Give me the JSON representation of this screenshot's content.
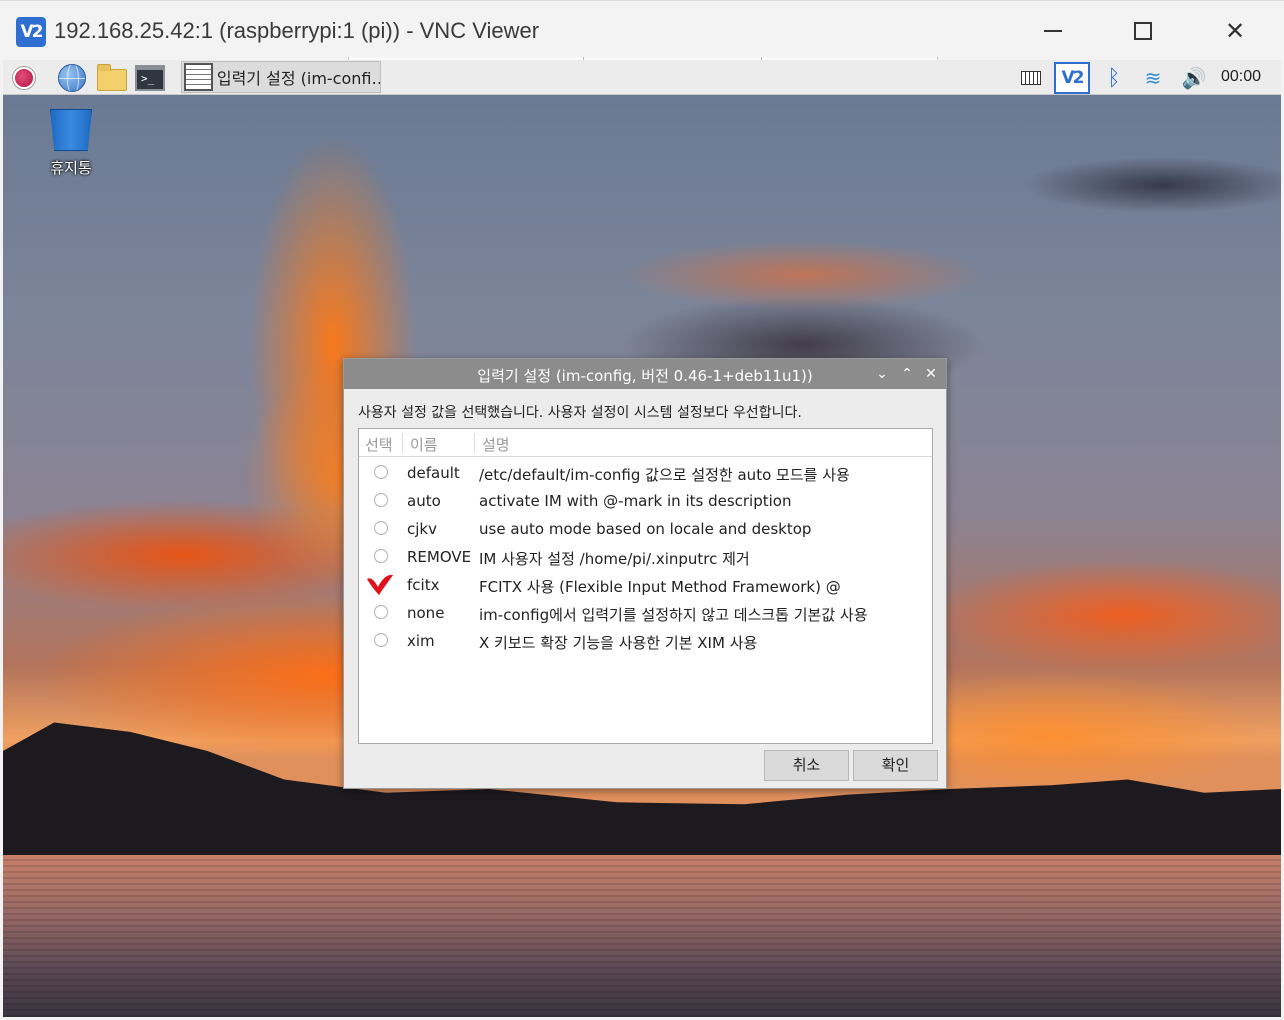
{
  "vnc": {
    "logo": "V2",
    "title": "192.168.25.42:1 (raspberrypi:1 (pi)) - VNC Viewer",
    "minimize_icon": "minimize-icon",
    "maximize_icon": "maximize-icon",
    "close_glyph": "✕"
  },
  "taskbar": {
    "launchers": [
      "raspberry-menu-icon",
      "browser-globe-icon",
      "file-manager-icon",
      "terminal-icon"
    ],
    "terminal_glyph": ">_",
    "active_task_label": "입력기 설정 (im-confi…",
    "tray_icons": [
      "keyboard-icon",
      "vnc-server-icon",
      "bluetooth-icon",
      "wifi-icon",
      "volume-icon"
    ],
    "vnc_tray_glyph": "V2",
    "bluetooth_glyph": "ᛒ",
    "wifi_glyph": "≋",
    "volume_glyph": "🔊",
    "clock": "00:00"
  },
  "desktop": {
    "trash_label": "휴지통"
  },
  "dialog": {
    "title": "입력기 설정 (im-config, 버전 0.46-1+deb11u1))",
    "controls": {
      "minimize": "⌄",
      "maximize": "⌃",
      "close": "✕"
    },
    "message": "사용자 설정 값을 선택했습니다. 사용자 설정이 시스템 설정보다 우선합니다.",
    "columns": [
      "선택",
      "이름",
      "설명"
    ],
    "rows": [
      {
        "selected": false,
        "name": "default",
        "desc": "/etc/default/im-config 값으로 설정한 auto 모드를 사용"
      },
      {
        "selected": false,
        "name": "auto",
        "desc": "activate IM with @-mark in its description"
      },
      {
        "selected": false,
        "name": "cjkv",
        "desc": "use auto mode based on locale and desktop"
      },
      {
        "selected": false,
        "name": "REMOVE",
        "desc": "IM 사용자 설정 /home/pi/.xinputrc 제거"
      },
      {
        "selected": true,
        "name": "fcitx",
        "desc": "FCITX 사용 (Flexible Input Method Framework) @"
      },
      {
        "selected": false,
        "name": "none",
        "desc": "im-config에서 입력기를 설정하지 않고 데스크톱 기본값 사용"
      },
      {
        "selected": false,
        "name": "xim",
        "desc": "X 키보드 확장 기능을 사용한 기본 XIM 사용"
      }
    ],
    "cancel_label": "취소",
    "ok_label": "확인",
    "check_color": "#e0111c"
  }
}
